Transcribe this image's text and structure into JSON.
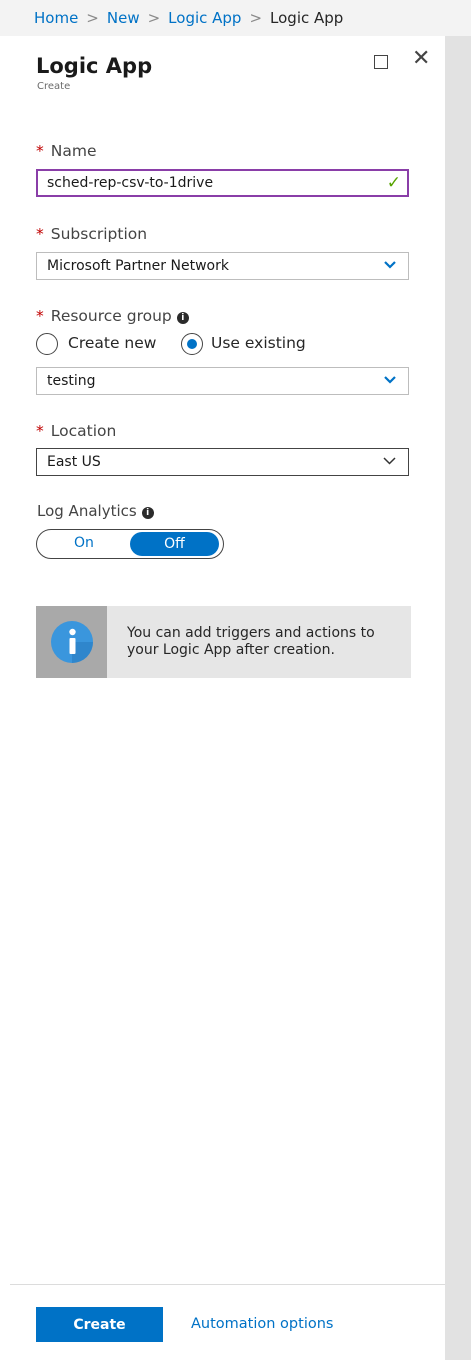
{
  "breadcrumb": {
    "items": [
      "Home",
      "New",
      "Logic App"
    ],
    "current": "Logic App"
  },
  "blade": {
    "title": "Logic App",
    "subtitle": "Create"
  },
  "form": {
    "required_mark": "*",
    "name": {
      "label": "Name",
      "value": "sched-rep-csv-to-1drive",
      "valid_icon": "checkmark-icon"
    },
    "subscription": {
      "label": "Subscription",
      "value": "Microsoft Partner Network"
    },
    "resource_group": {
      "label": "Resource group",
      "options": [
        "Create new",
        "Use existing"
      ],
      "selected": "Use existing",
      "value": "testing"
    },
    "location": {
      "label": "Location",
      "value": "East US"
    },
    "log_analytics": {
      "label": "Log Analytics",
      "on_label": "On",
      "off_label": "Off",
      "selected": "Off"
    }
  },
  "info_message": "You can add triggers and actions to your Logic App after creation.",
  "footer": {
    "create_label": "Create",
    "automation_label": "Automation options"
  },
  "colors": {
    "accent": "#0072c6",
    "required": "#c00000",
    "valid": "#57a300",
    "focus_border": "#8a3ea8"
  }
}
